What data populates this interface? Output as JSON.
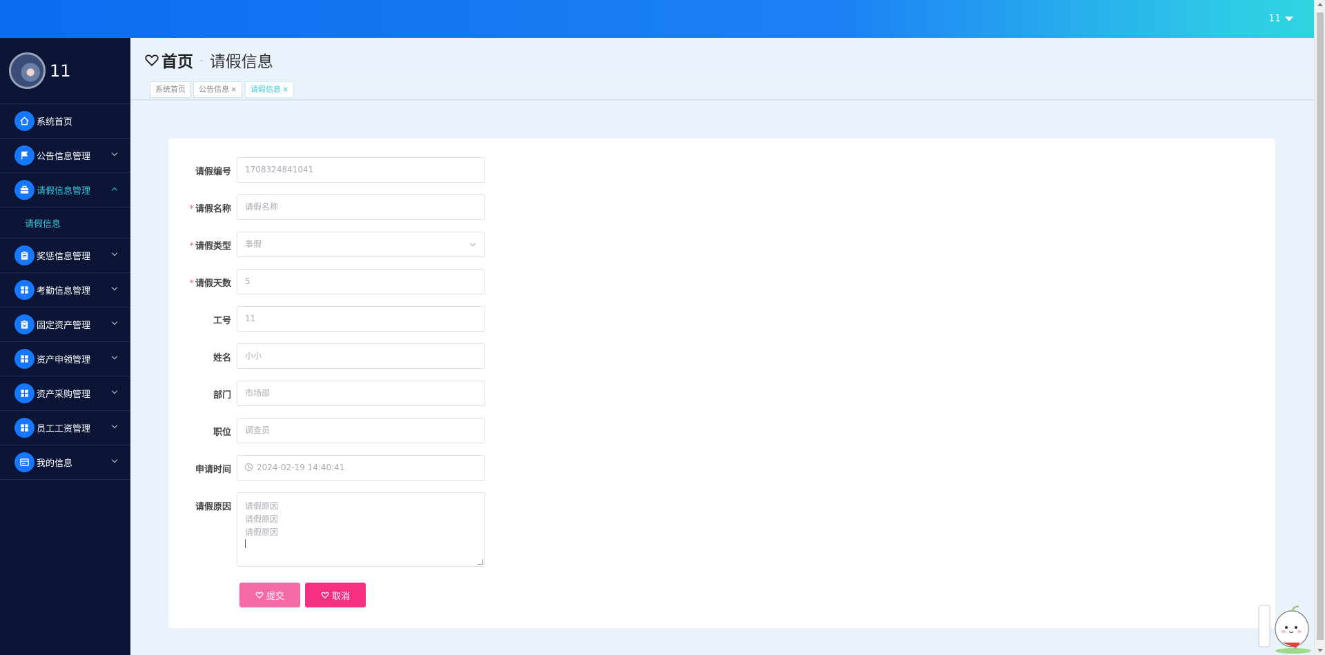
{
  "topbar": {
    "user_label": "11"
  },
  "sidebar": {
    "username": "11",
    "items": [
      {
        "label": "系统首页",
        "icon": "home-icon"
      },
      {
        "label": "公告信息管理",
        "icon": "flag-icon"
      },
      {
        "label": "请假信息管理",
        "icon": "briefcase-icon",
        "expanded": true
      },
      {
        "label": "奖惩信息管理",
        "icon": "clipboard-icon"
      },
      {
        "label": "考勤信息管理",
        "icon": "grid-icon"
      },
      {
        "label": "固定资产管理",
        "icon": "clipboard-icon"
      },
      {
        "label": "资产申领管理",
        "icon": "grid-icon"
      },
      {
        "label": "资产采购管理",
        "icon": "grid-icon"
      },
      {
        "label": "员工工资管理",
        "icon": "grid-icon"
      },
      {
        "label": "我的信息",
        "icon": "card-icon"
      }
    ],
    "submenu": {
      "label": "请假信息"
    }
  },
  "breadcrumb": {
    "home": "首页",
    "separator": "-",
    "current": "请假信息"
  },
  "tabs": [
    {
      "label": "系统首页",
      "closable": false
    },
    {
      "label": "公告信息",
      "closable": true
    },
    {
      "label": "请假信息",
      "closable": true,
      "active": true
    }
  ],
  "form": {
    "fields": [
      {
        "label": "请假编号",
        "required": false,
        "value": "1708324841041"
      },
      {
        "label": "请假名称",
        "required": true,
        "placeholder": "请假名称"
      },
      {
        "label": "请假类型",
        "required": true,
        "value": "事假"
      },
      {
        "label": "请假天数",
        "required": true,
        "value": "5"
      },
      {
        "label": "工号",
        "required": false,
        "value": "11"
      },
      {
        "label": "姓名",
        "required": false,
        "value": "小小"
      },
      {
        "label": "部门",
        "required": false,
        "value": "市场部"
      },
      {
        "label": "职位",
        "required": false,
        "value": "调查员"
      },
      {
        "label": "申请时间",
        "required": false,
        "value": "2024-02-19 14:40:41"
      }
    ],
    "reason": {
      "label": "请假原因",
      "lines": [
        "请假原因",
        "请假原因",
        "请假原因"
      ]
    },
    "submit_label": "提交",
    "cancel_label": "取消"
  },
  "colors": {
    "accent": "#37c8d8",
    "sidebar_bg": "#0c1535",
    "icon_bg": "#1677ff",
    "submit_bg": "#f56aa4",
    "cancel_bg": "#f62f83",
    "required_star": "#f56c6c"
  }
}
